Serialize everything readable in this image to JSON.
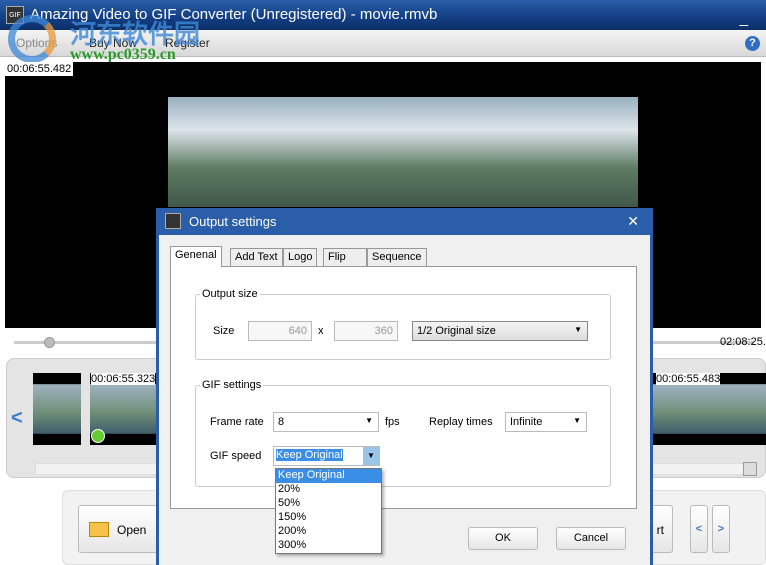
{
  "window": {
    "title": "Amazing Video to GIF Converter (Unregistered) - movie.rmvb",
    "minimize": "_"
  },
  "menu": {
    "items": [
      "Options",
      "Buy Now",
      "Register"
    ],
    "help": "?"
  },
  "watermark": {
    "cn": "河东软件园",
    "url": "www.pc0359.cn"
  },
  "player": {
    "current_time": "00:06:55.482",
    "end_time": "02:08:25.",
    "position": 0.05
  },
  "filmstrip": {
    "frames": [
      "00:06:55.323",
      "00:06:55.483"
    ]
  },
  "bottom": {
    "open_label": "Open",
    "partial_label": "rt"
  },
  "dialog": {
    "title": "Output settings",
    "close": "✕",
    "tabs": [
      "Genenal",
      "Add Text",
      "Logo",
      "Flip",
      "Sequence"
    ],
    "output_size": {
      "label": "Output size",
      "size_label": "Size",
      "width": "640",
      "x": "x",
      "height": "360",
      "preset": "1/2 Original size"
    },
    "gif_settings": {
      "label": "GIF settings",
      "frame_rate_label": "Frame rate",
      "frame_rate": "8",
      "fps": "fps",
      "replay_label": "Replay times",
      "replay": "Infinite",
      "speed_label": "GIF speed",
      "speed": "Keep Original",
      "speed_options": [
        "Keep Original",
        "20%",
        "50%",
        "150%",
        "200%",
        "300%"
      ]
    },
    "ok": "OK",
    "cancel": "Cancel"
  }
}
